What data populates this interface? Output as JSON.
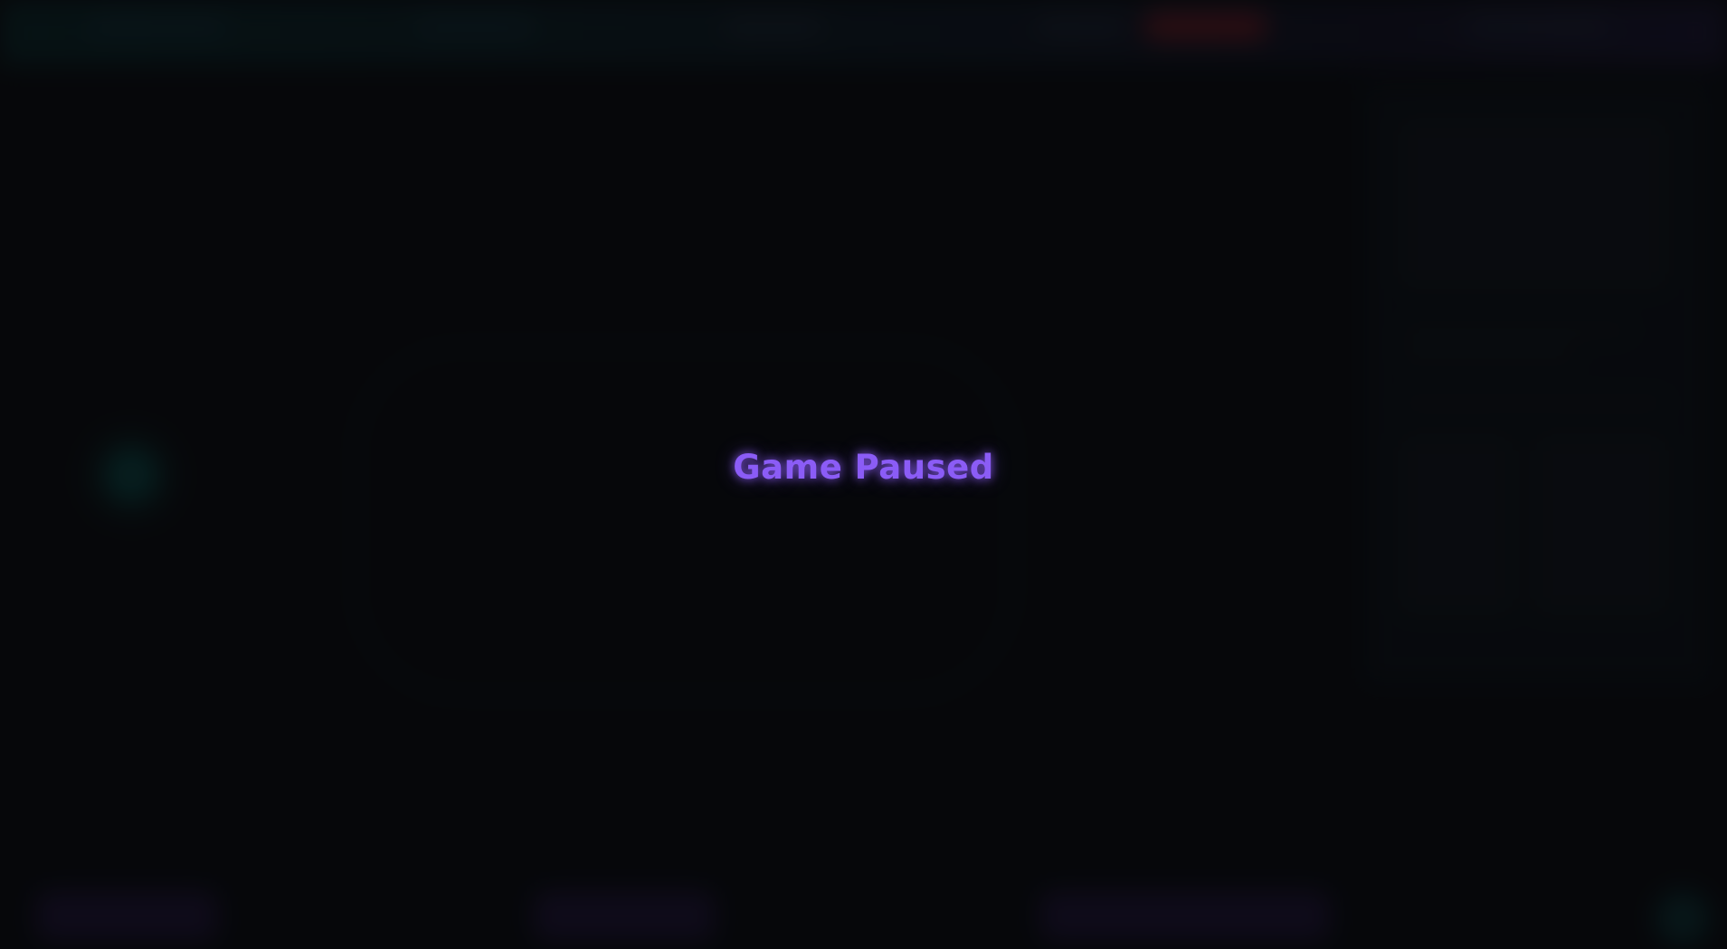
{
  "overlay": {
    "title": "Game Paused"
  },
  "colors": {
    "accent": "#8b5cf6",
    "background": "#0a0b0f",
    "player": "#0e6560",
    "alert": "#be2832"
  }
}
